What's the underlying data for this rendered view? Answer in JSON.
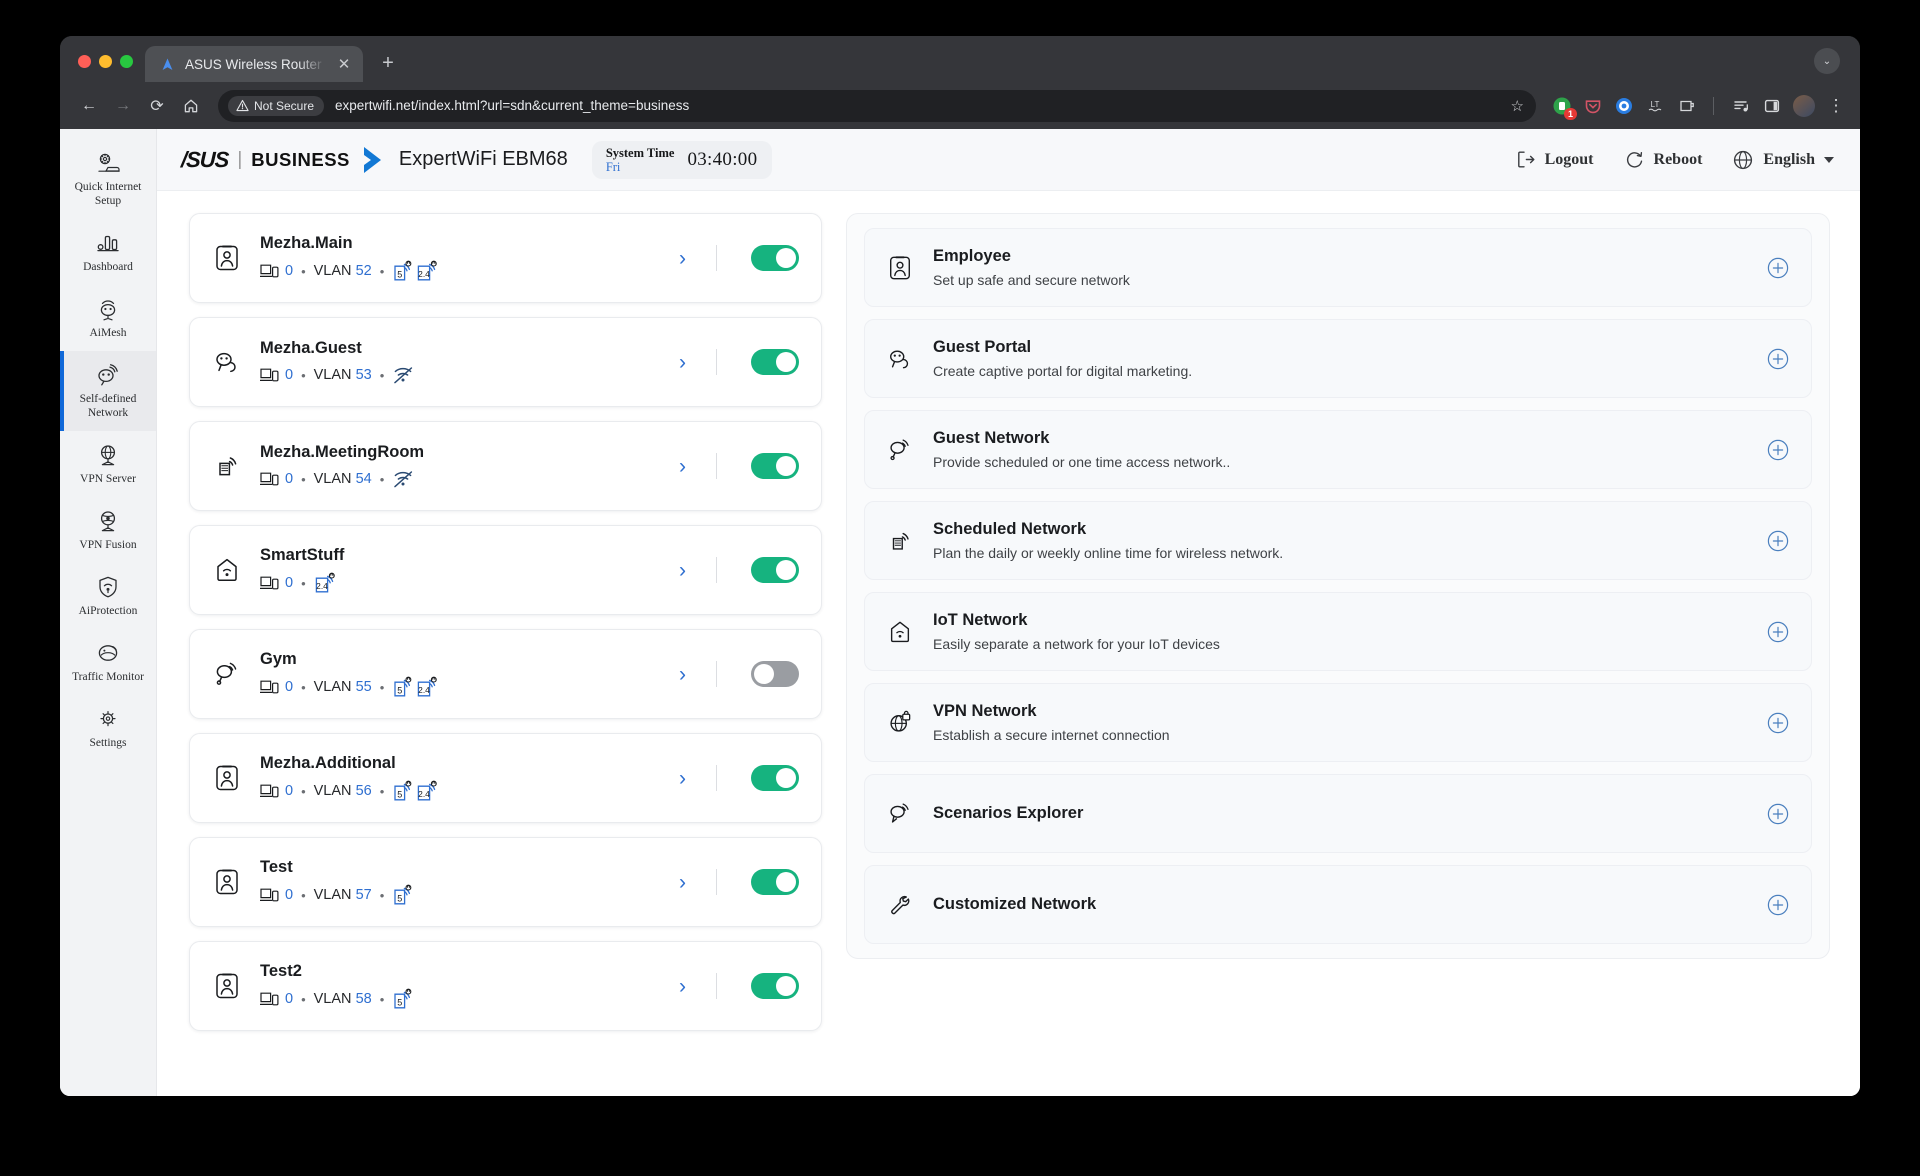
{
  "browser": {
    "tab": {
      "title": "ASUS Wireless Router Exper",
      "favicon_name": "asus-logo-favicon",
      "close_label": "✕"
    },
    "new_tab_label": "+",
    "window_caret_label": "⌄",
    "nav": {
      "back": "←",
      "forward": "→",
      "reload": "⟳",
      "home": "⌂"
    },
    "security_label": "Not Secure",
    "url": "expertwifi.net/index.html?url=sdn&current_theme=business",
    "bookmark_label": "☆",
    "extensions": [
      {
        "name": "extension-green-badge",
        "badge": "1"
      },
      {
        "name": "pocket-extension",
        "badge": ""
      },
      {
        "name": "privacy-extension",
        "badge": ""
      },
      {
        "name": "languagetool-extension",
        "badge": ""
      },
      {
        "name": "clipboard-extension",
        "badge": ""
      },
      {
        "name": "reading-list-icon",
        "badge": ""
      },
      {
        "name": "side-panel-icon",
        "badge": ""
      }
    ],
    "kebab_label": "⋮"
  },
  "sidebar": {
    "items": [
      {
        "label": "Quick Internet Setup",
        "icon": "quick-internet-setup-icon",
        "active": false
      },
      {
        "label": "Dashboard",
        "icon": "dashboard-icon",
        "active": false
      },
      {
        "label": "AiMesh",
        "icon": "aimesh-icon",
        "active": false
      },
      {
        "label": "Self-defined Network",
        "icon": "self-defined-network-icon",
        "active": true
      },
      {
        "label": "VPN Server",
        "icon": "vpn-server-icon",
        "active": false
      },
      {
        "label": "VPN Fusion",
        "icon": "vpn-fusion-icon",
        "active": false
      },
      {
        "label": "AiProtection",
        "icon": "aiprotection-icon",
        "active": false
      },
      {
        "label": "Traffic Monitor",
        "icon": "traffic-monitor-icon",
        "active": false
      },
      {
        "label": "Settings",
        "icon": "settings-gear-icon",
        "active": false
      }
    ]
  },
  "header": {
    "logo_text": "/SUS",
    "separator": "|",
    "business_label": "BUSINESS",
    "model": "ExpertWiFi EBM68",
    "system_time_label": "System Time",
    "system_time_day": "Fri",
    "system_time_clock": "03:40:00",
    "logout_label": "Logout",
    "reboot_label": "Reboot",
    "language_label": "English",
    "accent_blue": "#2f6fd0",
    "toggle_green": "#16b37f"
  },
  "networks": [
    {
      "name": "Mezha.Main",
      "icon": "employee-badge-icon",
      "devices": "0",
      "vlan_label": "VLAN",
      "vlan": "52",
      "bands": [
        "5",
        "2.4"
      ],
      "wifi_off": false,
      "enabled": true
    },
    {
      "name": "Mezha.Guest",
      "icon": "guest-portal-icon",
      "devices": "0",
      "vlan_label": "VLAN",
      "vlan": "53",
      "bands": [],
      "wifi_off": true,
      "enabled": true
    },
    {
      "name": "Mezha.MeetingRoom",
      "icon": "scheduled-network-icon",
      "devices": "0",
      "vlan_label": "VLAN",
      "vlan": "54",
      "bands": [],
      "wifi_off": true,
      "enabled": true
    },
    {
      "name": "SmartStuff",
      "icon": "iot-network-icon",
      "devices": "0",
      "vlan_label": "",
      "vlan": "",
      "bands": [
        "2.4"
      ],
      "wifi_off": false,
      "enabled": true
    },
    {
      "name": "Gym",
      "icon": "guest-network-icon",
      "devices": "0",
      "vlan_label": "VLAN",
      "vlan": "55",
      "bands": [
        "5",
        "2.4"
      ],
      "wifi_off": false,
      "enabled": false
    },
    {
      "name": "Mezha.Additional",
      "icon": "employee-badge-icon",
      "devices": "0",
      "vlan_label": "VLAN",
      "vlan": "56",
      "bands": [
        "5",
        "2.4"
      ],
      "wifi_off": false,
      "enabled": true
    },
    {
      "name": "Test",
      "icon": "employee-badge-icon",
      "devices": "0",
      "vlan_label": "VLAN",
      "vlan": "57",
      "bands": [
        "5"
      ],
      "wifi_off": false,
      "enabled": true
    },
    {
      "name": "Test2",
      "icon": "employee-badge-icon",
      "devices": "0",
      "vlan_label": "VLAN",
      "vlan": "58",
      "bands": [
        "5"
      ],
      "wifi_off": false,
      "enabled": true
    }
  ],
  "features": [
    {
      "title": "Employee",
      "subtitle": "Set up safe and secure network",
      "icon": "employee-badge-icon",
      "add_label": "+"
    },
    {
      "title": "Guest Portal",
      "subtitle": "Create captive portal for digital marketing.",
      "icon": "guest-portal-icon",
      "add_label": "+"
    },
    {
      "title": "Guest Network",
      "subtitle": "Provide scheduled or one time access network..",
      "icon": "guest-network-icon",
      "add_label": "+"
    },
    {
      "title": "Scheduled Network",
      "subtitle": "Plan the daily or weekly online time for wireless network.",
      "icon": "scheduled-network-icon",
      "add_label": "+"
    },
    {
      "title": "IoT Network",
      "subtitle": "Easily separate a network for your IoT devices",
      "icon": "iot-network-icon",
      "add_label": "+"
    },
    {
      "title": "VPN Network",
      "subtitle": "Establish a secure internet connection",
      "icon": "vpn-network-icon",
      "add_label": "+"
    },
    {
      "title": "Scenarios Explorer",
      "subtitle": "",
      "icon": "scenarios-explorer-icon",
      "add_label": "+"
    },
    {
      "title": "Customized Network",
      "subtitle": "",
      "icon": "customized-network-icon",
      "add_label": "+"
    }
  ]
}
